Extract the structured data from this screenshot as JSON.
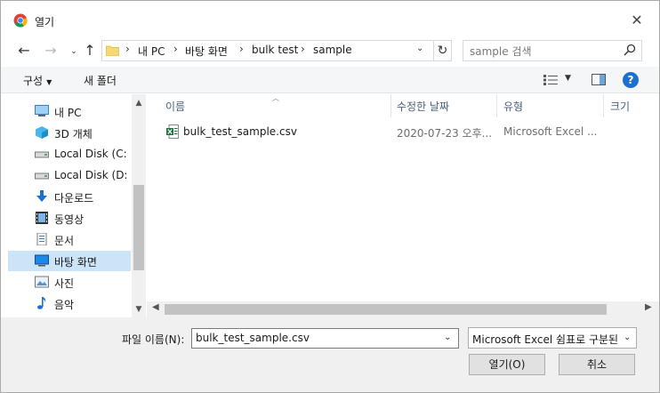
{
  "window": {
    "title": "열기"
  },
  "address": {
    "crumbs": [
      "내 PC",
      "바탕 화면",
      "bulk test",
      "sample"
    ]
  },
  "search": {
    "placeholder": "sample 검색"
  },
  "toolbar": {
    "organize": "구성",
    "new_folder": "새 폴더",
    "help": "?"
  },
  "nav": {
    "items": [
      {
        "label": "내 PC",
        "icon": "computer-icon"
      },
      {
        "label": "3D 개체",
        "icon": "3d-objects-icon"
      },
      {
        "label": "Local Disk (C: o",
        "icon": "drive-icon"
      },
      {
        "label": "Local Disk (D: o",
        "icon": "drive-icon"
      },
      {
        "label": "다운로드",
        "icon": "download-icon"
      },
      {
        "label": "동영상",
        "icon": "video-icon"
      },
      {
        "label": "문서",
        "icon": "document-icon"
      },
      {
        "label": "바탕 화면",
        "icon": "desktop-icon",
        "selected": true
      },
      {
        "label": "사진",
        "icon": "pictures-icon"
      },
      {
        "label": "음악",
        "icon": "music-icon"
      }
    ]
  },
  "columns": {
    "name": "이름",
    "modified": "수정한 날짜",
    "type": "유형",
    "size": "크기"
  },
  "files": [
    {
      "name": "bulk_test_sample.csv",
      "modified": "2020-07-23 오후...",
      "type": "Microsoft Excel ...",
      "icon": "excel-csv-icon"
    }
  ],
  "footer": {
    "filename_label": "파일 이름(N):",
    "filename_value": "bulk_test_sample.csv",
    "filetype_value": "Microsoft Excel 쉼표로 구분된",
    "open_label": "열기(O)",
    "cancel_label": "취소"
  },
  "colors": {
    "selection": "#cce4f7",
    "accent": "#1e70d0",
    "footer_bg": "#f0f0f0"
  }
}
